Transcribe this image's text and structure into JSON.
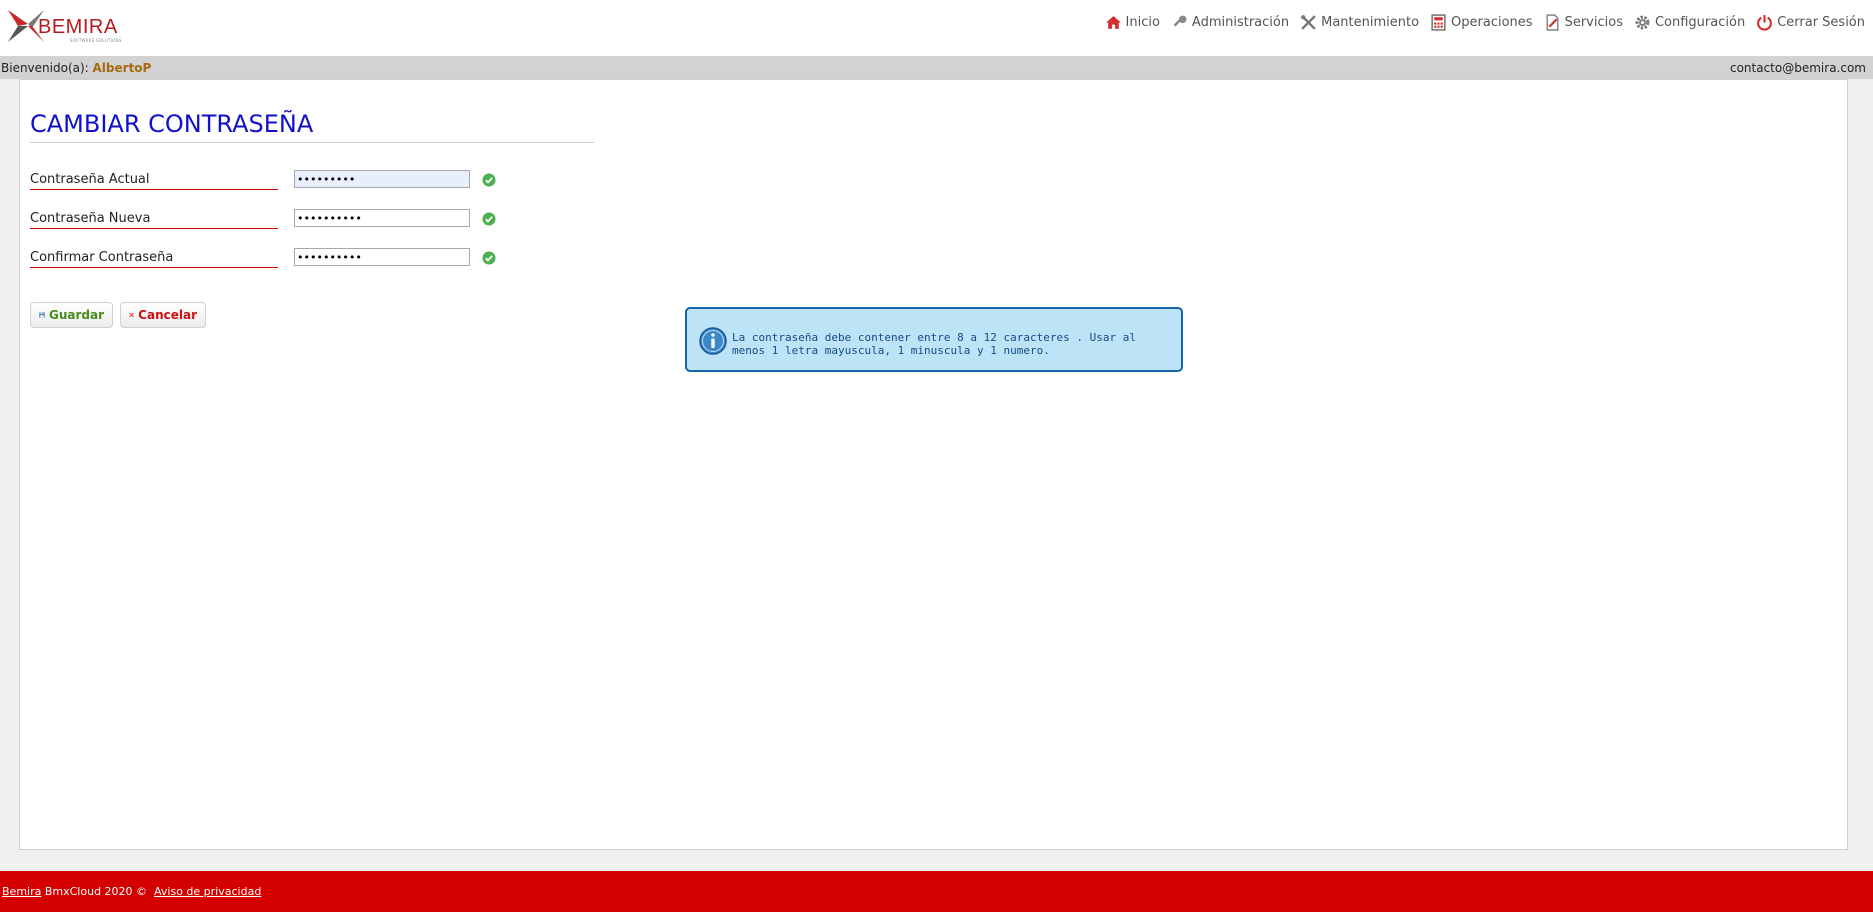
{
  "header": {
    "logo_text": "BEMIRA",
    "logo_tagline": "SOFTWARE SOLUTIONS",
    "nav": [
      {
        "label": "Inicio",
        "icon": "home-icon"
      },
      {
        "label": "Administración",
        "icon": "key-icon"
      },
      {
        "label": "Mantenimiento",
        "icon": "tools-icon"
      },
      {
        "label": "Operaciones",
        "icon": "calculator-icon"
      },
      {
        "label": "Servicios",
        "icon": "edit-document-icon"
      },
      {
        "label": "Configuración",
        "icon": "gear-icon"
      },
      {
        "label": "Cerrar Sesión",
        "icon": "power-icon"
      }
    ]
  },
  "welcome": {
    "prefix": "Bienvenido(a): ",
    "user": "AlbertoP",
    "contact": "contacto@bemira.com"
  },
  "page": {
    "title": "CAMBIAR CONTRASEÑA",
    "fields": [
      {
        "label": "Contraseña Actual",
        "value": "123456789"
      },
      {
        "label": "Contraseña Nueva",
        "value": "1234567890"
      },
      {
        "label": "Confirmar Contraseña",
        "value": "1234567890"
      }
    ],
    "save_label": "Guardar",
    "cancel_label": "Cancelar",
    "info_message": "La contraseña debe contener entre 8 a 12 caracteres . Usar al menos 1 letra mayuscula, 1 minuscula y 1 numero."
  },
  "footer": {
    "brand_link": "Bemira",
    "text": " BmxCloud 2020 ©  ",
    "privacy_link": "Aviso de privacidad"
  },
  "colors": {
    "accent_red": "#d40000",
    "title_blue": "#1111cc",
    "info_bg": "#bde4f6",
    "info_border": "#1665a8",
    "welcome_bar": "#d2d2d2"
  }
}
